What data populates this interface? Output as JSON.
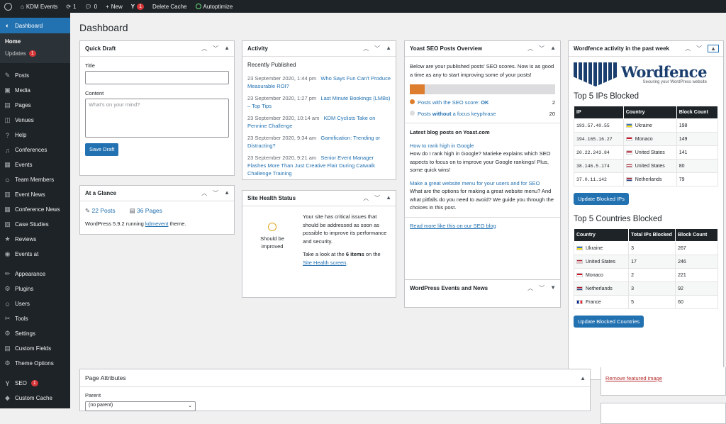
{
  "adminbar": {
    "site": "KDM Events",
    "updates": "1",
    "comments": "0",
    "new": "New",
    "yoast_badge": "1",
    "delete_cache": "Delete Cache",
    "autoptimize": "Autoptimize"
  },
  "sidebar": {
    "dashboard": "Dashboard",
    "home": "Home",
    "updates": "Updates",
    "updates_badge": "1",
    "items": [
      "Posts",
      "Media",
      "Pages",
      "Venues",
      "Help",
      "Conferences",
      "Events",
      "Team Members",
      "Event News",
      "Conference News",
      "Case Studies",
      "Reviews",
      "Events at"
    ],
    "items2": [
      "Appearance",
      "Plugins",
      "Users",
      "Tools",
      "Settings",
      "Custom Fields",
      "Theme Options"
    ],
    "seo": "SEO",
    "seo_badge": "1",
    "custom_cache": "Custom Cache"
  },
  "page_title": "Dashboard",
  "quick_draft": {
    "title": "Quick Draft",
    "title_label": "Title",
    "content_label": "Content",
    "content_placeholder": "What's on your mind?",
    "save": "Save Draft"
  },
  "glance": {
    "title": "At a Glance",
    "posts": "22 Posts",
    "pages": "36 Pages",
    "running_pre": "WordPress 5.9.2 running",
    "theme": "kdmevent",
    "running_post": "theme."
  },
  "activity": {
    "title": "Activity",
    "recent": "Recently Published",
    "items": [
      {
        "date": "23 September 2020, 1:44 pm",
        "title": "Who Says Fun Can't Produce Measurable ROI?"
      },
      {
        "date": "23 September 2020, 1:27 pm",
        "title": "Last Minute Bookings (LMBs) – Top Tips"
      },
      {
        "date": "23 September 2020, 10:14 am",
        "title": "KDM Cyclists Take on Pennine Challenge"
      },
      {
        "date": "23 September 2020, 9:34 am",
        "title": "Gamification: Trending or Distracting?"
      },
      {
        "date": "23 September 2020, 9:21 am",
        "title": "Senior Event Manager Flashes More Than Just Creative Flair During Catwalk Challenge Training"
      }
    ]
  },
  "site_health": {
    "title": "Site Health Status",
    "status": "Should be improved",
    "msg": "Your site has critical issues that should be addressed as soon as possible to improve its performance and security.",
    "take_pre": "Take a look at the",
    "items": "6 items",
    "take_mid": "on the",
    "link": "Site Health screen",
    "take_post": "."
  },
  "yoast": {
    "title": "Yoast SEO Posts Overview",
    "intro": "Below are your published posts' SEO scores. Now is as good a time as any to start improving some of your posts!",
    "ok_progress": 0.1,
    "row1_pre": "Posts with the SEO score:",
    "row1_strong": "OK",
    "row1_count": "2",
    "row2_pre": "Posts",
    "row2_strong": "without",
    "row2_post": "a focus keyphrase",
    "row2_count": "20",
    "latest": "Latest blog posts on Yoast.com",
    "post1_link": "How to rank high in Google",
    "post1_text": "How do I rank high in Google? Marieke explains which SEO aspects to focus on to improve your Google rankings! Plus, some quick wins!",
    "post2_link": "Make a great website menu for your users and for SEO",
    "post2_text": "What are the options for making a great website menu? And what pitfalls do you need to avoid? We guide you through the choices in this post.",
    "read_more": "Read more like this on our SEO blog",
    "color_ok": "#dd7d2e",
    "color_none": "#dcdcde"
  },
  "wp_events": {
    "title": "WordPress Events and News"
  },
  "wordfence": {
    "title": "Wordfence activity in the past week",
    "logo": "Wordfence",
    "tagline": "Securing your WordPress website",
    "ips_title": "Top 5 IPs Blocked",
    "ips_headers": [
      "IP",
      "Country",
      "Block Count"
    ],
    "ips": [
      {
        "ip": "193.57.40.55",
        "country": "Ukraine",
        "count": "198",
        "flag": "ua"
      },
      {
        "ip": "194.165.16.27",
        "country": "Monaco",
        "count": "149",
        "flag": "mc"
      },
      {
        "ip": "20.22.243.84",
        "country": "United States",
        "count": "141",
        "flag": "us"
      },
      {
        "ip": "38.146.5.174",
        "country": "United States",
        "count": "80",
        "flag": "us"
      },
      {
        "ip": "37.0.11.142",
        "country": "Netherlands",
        "count": "79",
        "flag": "nl"
      }
    ],
    "ips_btn": "Update Blocked IPs",
    "countries_title": "Top 5 Countries Blocked",
    "countries_headers": [
      "Country",
      "Total IPs Blocked",
      "Block Count"
    ],
    "countries": [
      {
        "country": "Ukraine",
        "total": "3",
        "count": "267",
        "flag": "ua"
      },
      {
        "country": "United States",
        "total": "17",
        "count": "246",
        "flag": "us"
      },
      {
        "country": "Monaco",
        "total": "2",
        "count": "221",
        "flag": "mc"
      },
      {
        "country": "Netherlands",
        "total": "3",
        "count": "92",
        "flag": "nl"
      },
      {
        "country": "France",
        "total": "5",
        "count": "60",
        "flag": "fr"
      }
    ],
    "countries_btn": "Update Blocked Countries"
  },
  "page_attributes": {
    "title": "Page Attributes",
    "parent": "Parent",
    "select": "(no parent)"
  },
  "featured": {
    "remove": "Remove featured image"
  }
}
